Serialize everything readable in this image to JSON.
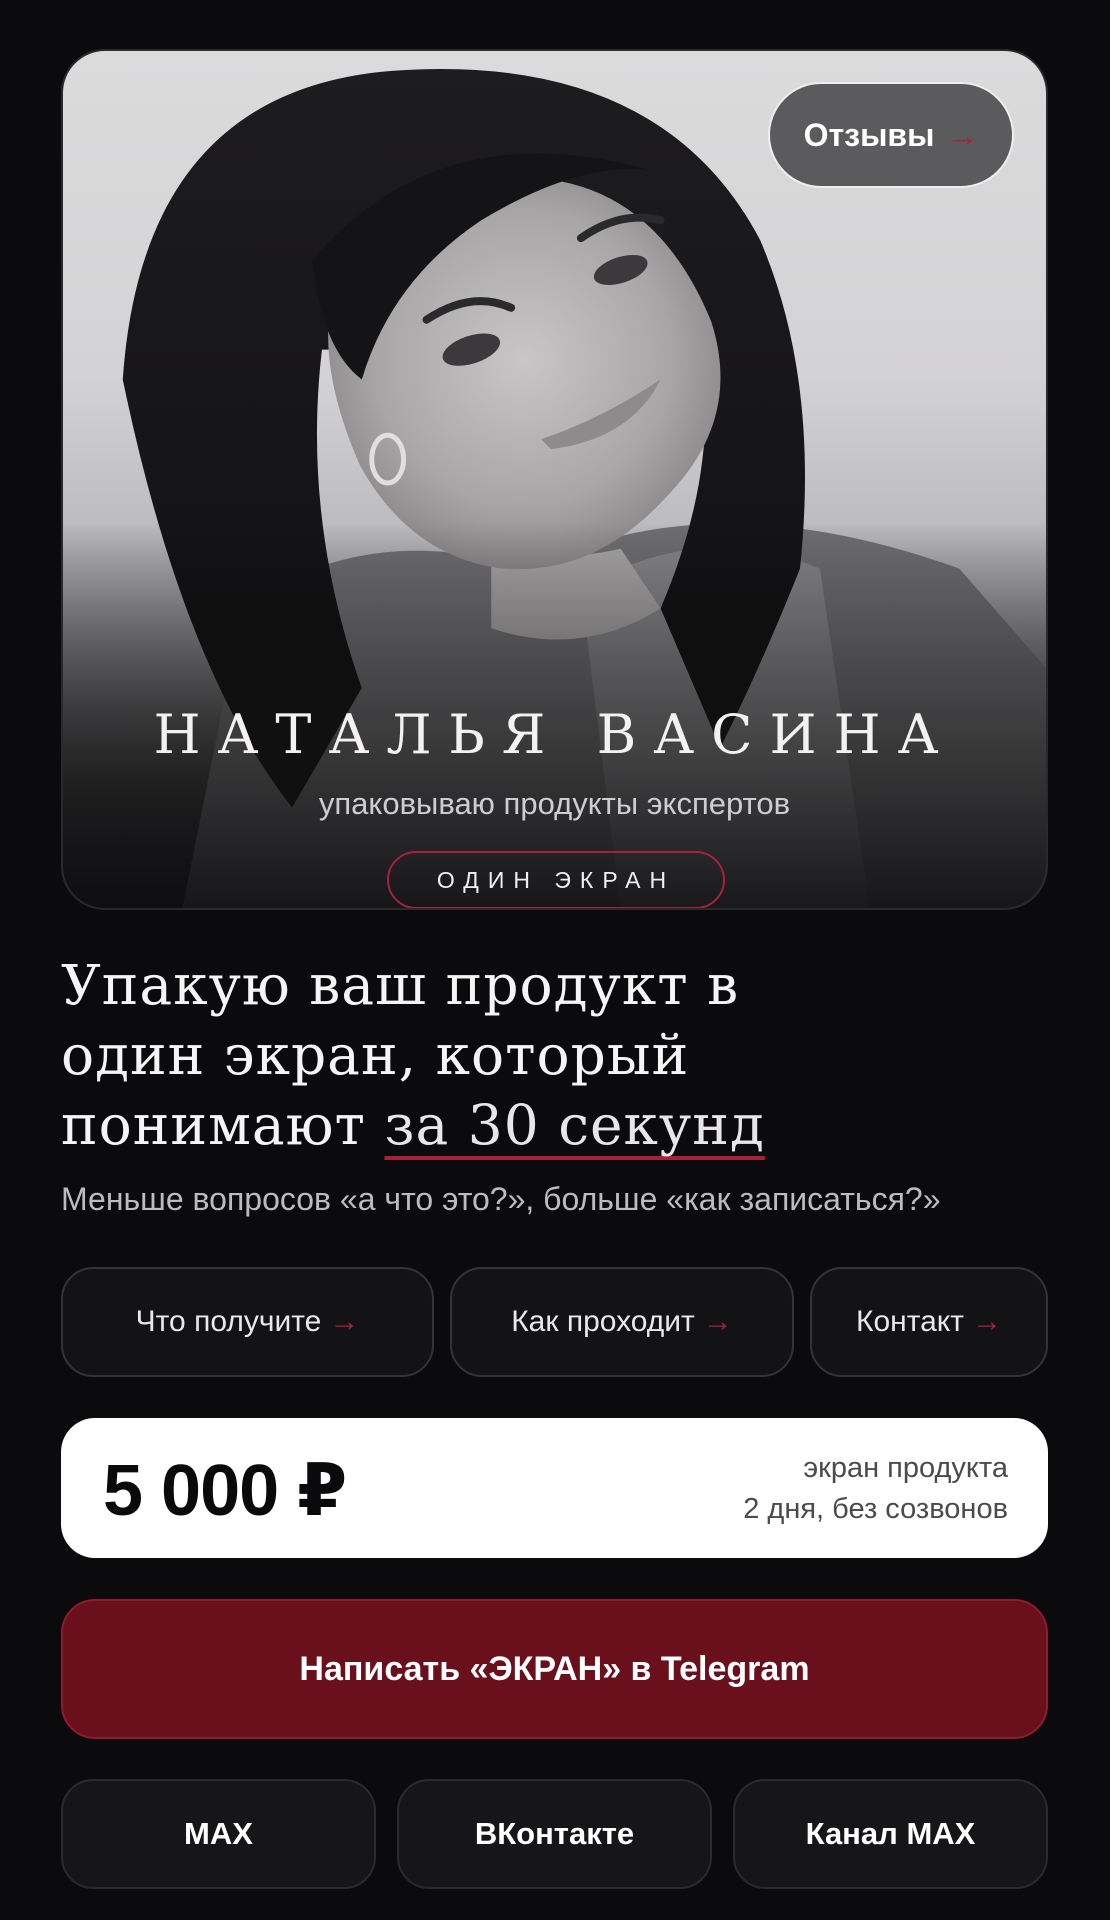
{
  "hero": {
    "reviews_label": "Отзывы",
    "arrow": "→",
    "name": "НАТАЛЬЯ ВАСИНА",
    "subtitle": "упаковываю продукты экспертов",
    "badge": "ОДИН ЭКРАН"
  },
  "headline": {
    "line1": "Упакую ваш продукт в",
    "line2": "один экран, который",
    "line3_start": "понимают ",
    "line3_accent": "за 30 секунд"
  },
  "subline": "Меньше вопросов «а что это?», больше «как записаться?»",
  "nav": [
    {
      "label": "Что получите",
      "arrow": "→"
    },
    {
      "label": "Как проходит",
      "arrow": "→"
    },
    {
      "label": "Контакт",
      "arrow": "→"
    }
  ],
  "price": {
    "value": "5 000 ₽",
    "meta_line1": "экран продукта",
    "meta_line2": "2 дня, без созвонов"
  },
  "cta": {
    "label": "Написать «ЭКРАН» в Telegram"
  },
  "alt_contacts": [
    {
      "label": "MAX"
    },
    {
      "label": "ВКонтакте"
    },
    {
      "label": "Канал MAX"
    }
  ],
  "colors": {
    "background": "#0b0a0c",
    "accent": "#a5233a",
    "cta": "#6a0f1c",
    "card": "#ffffff"
  }
}
